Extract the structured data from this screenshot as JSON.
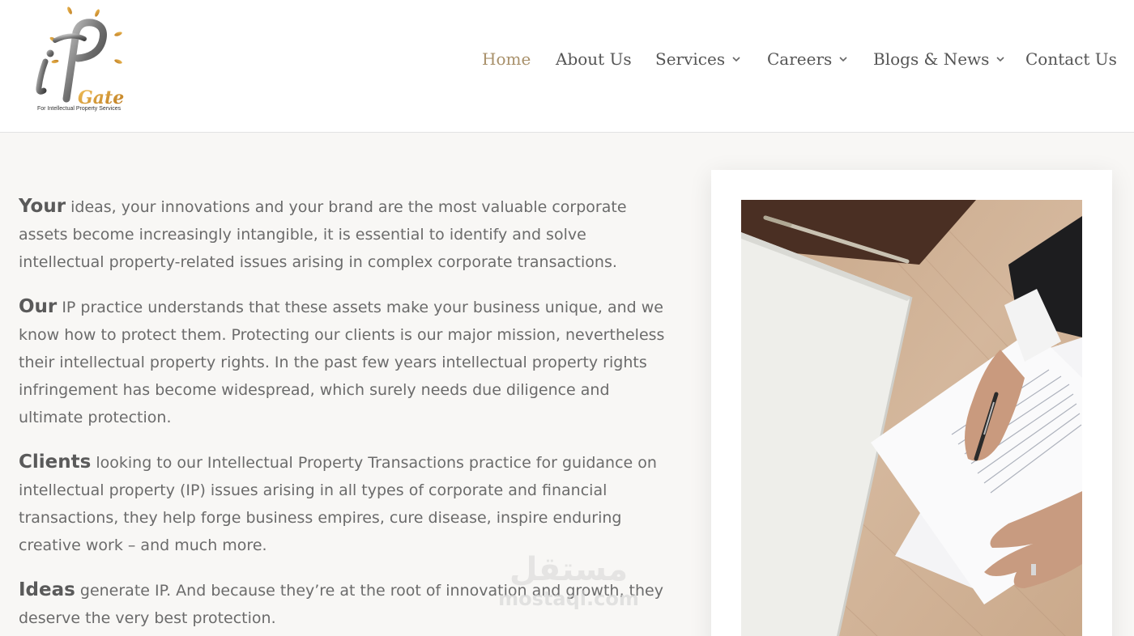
{
  "brand": {
    "logo_letters": "iP",
    "logo_word": "Gate",
    "tagline": "For Intellectual Property Services"
  },
  "nav": {
    "items": [
      {
        "label": "Home",
        "active": true,
        "has_dropdown": false
      },
      {
        "label": "About Us",
        "active": false,
        "has_dropdown": false
      },
      {
        "label": "Services",
        "active": false,
        "has_dropdown": true
      },
      {
        "label": "Careers",
        "active": false,
        "has_dropdown": true
      },
      {
        "label": "Blogs & News",
        "active": false,
        "has_dropdown": true
      },
      {
        "label": "Contact Us",
        "active": false,
        "has_dropdown": false
      }
    ]
  },
  "content": {
    "paragraphs": [
      {
        "lead": "Your",
        "text": " ideas, your innovations and your brand are the most valuable corporate assets become increasingly intangible, it is essential to identify and solve intellectual property-related issues arising in complex corporate transactions."
      },
      {
        "lead": "Our",
        "text": " IP practice understands that these assets make your business unique, and we know how to protect them. Protecting our clients is our major mission, nevertheless their intellectual property rights. In the past few years intellectual property rights infringement has become widespread, which surely needs due diligence and ultimate protection."
      },
      {
        "lead": "Clients",
        "text": " looking to our Intellectual Property Transactions practice for guidance on intellectual property (IP) issues arising in all types of corporate and financial transactions, they help forge business empires, cure disease, inspire enduring creative work – and much more."
      },
      {
        "lead": "Ideas",
        "text": " generate IP. And because they’re at the root of innovation and growth, they deserve the very best protection."
      }
    ]
  },
  "watermark": {
    "arabic": "مستقل",
    "latin": "mostaql.com"
  },
  "colors": {
    "accent": "#a8906a",
    "gold": "#d9a23a",
    "text": "#6b6b6b",
    "background": "#f8f7f5"
  }
}
